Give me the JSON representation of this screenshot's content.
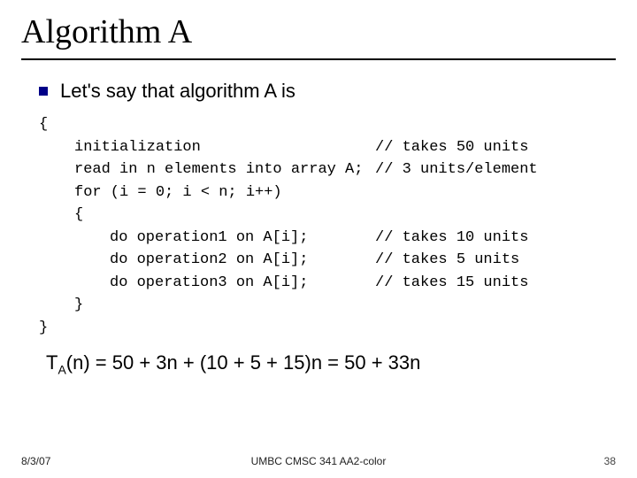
{
  "title": "Algorithm A",
  "bullet": "Let's say that algorithm A is",
  "code": {
    "open": "{",
    "l1": "initialization",
    "c1": "// takes 50 units",
    "l2": "read in n elements into array A;",
    "c2": "// 3 units/element",
    "l3": "for (i = 0; i < n; i++)",
    "l4": "{",
    "l5": "do operation1 on A[i];",
    "c5": "// takes 10 units",
    "l6": "do operation2 on A[i];",
    "c6": "// takes 5 units",
    "l7": "do operation3 on A[i];",
    "c7": "// takes 15 units",
    "l8": "}",
    "close": "}"
  },
  "equation_pre": "T",
  "equation_sub": "A",
  "equation_post": "(n) = 50 + 3n + (10 + 5 + 15)n = 50 + 33n",
  "footer": {
    "date": "8/3/07",
    "mid": "UMBC CMSC 341 AA2-color",
    "page": "38"
  }
}
